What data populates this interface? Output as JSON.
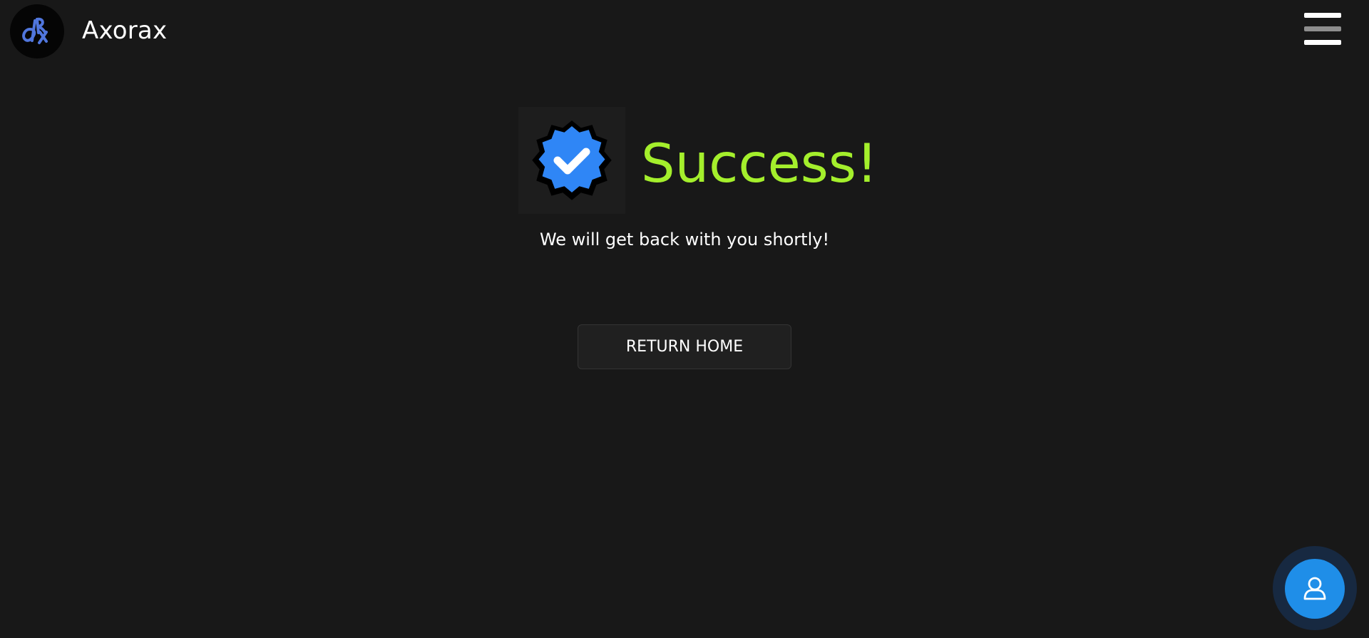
{
  "header": {
    "brand": "Axorax",
    "logo_icon": "axorax-logo-icon",
    "menu_icon": "hamburger-menu-icon"
  },
  "main": {
    "badge_icon": "verified-badge-check-icon",
    "title": "Success!",
    "message": "We will get back with you shortly!",
    "return_label": "RETURN HOME"
  },
  "floating": {
    "profile_icon": "user-icon"
  },
  "colors": {
    "background": "#181818",
    "title": "#a4ef2c",
    "badge": "#2f86f6",
    "fab": "#1f8ee8",
    "logo_letters": "#5076dd"
  }
}
